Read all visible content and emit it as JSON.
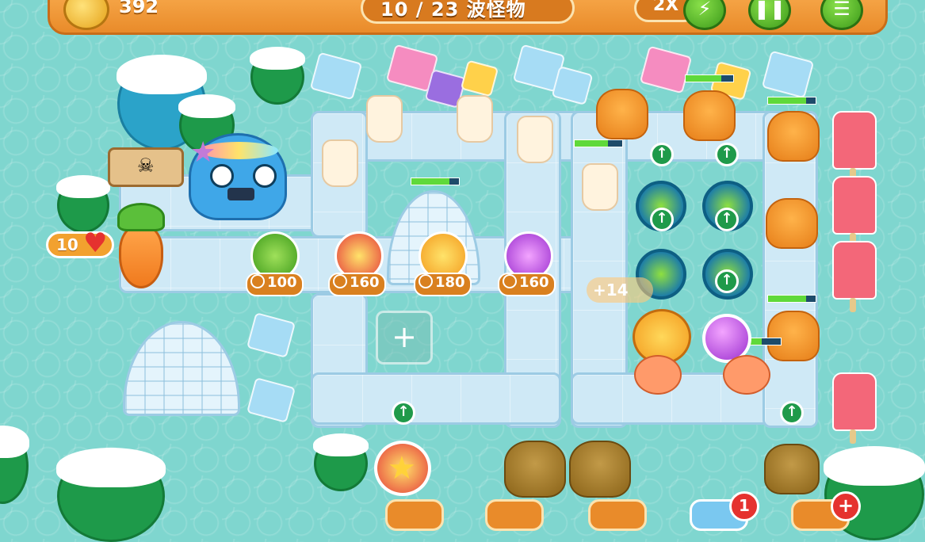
{
  "hud": {
    "coins": "392",
    "wave": "10 / 23 波怪物",
    "speed": "2X"
  },
  "lives": {
    "count": "10"
  },
  "build_menu": [
    {
      "name": "bottle-tower",
      "price": "100"
    },
    {
      "name": "star-tower",
      "price": "160"
    },
    {
      "name": "sun-tower",
      "price": "180"
    },
    {
      "name": "ball-tower",
      "price": "160"
    }
  ],
  "empty_slot": {
    "symbol": "+"
  },
  "floating_reward": "+14",
  "badges": {
    "notification": "1",
    "add": "+"
  },
  "colors": {
    "accent": "#e98b2a",
    "path": "#cfe9f6",
    "ground": "#7fd6cf"
  }
}
